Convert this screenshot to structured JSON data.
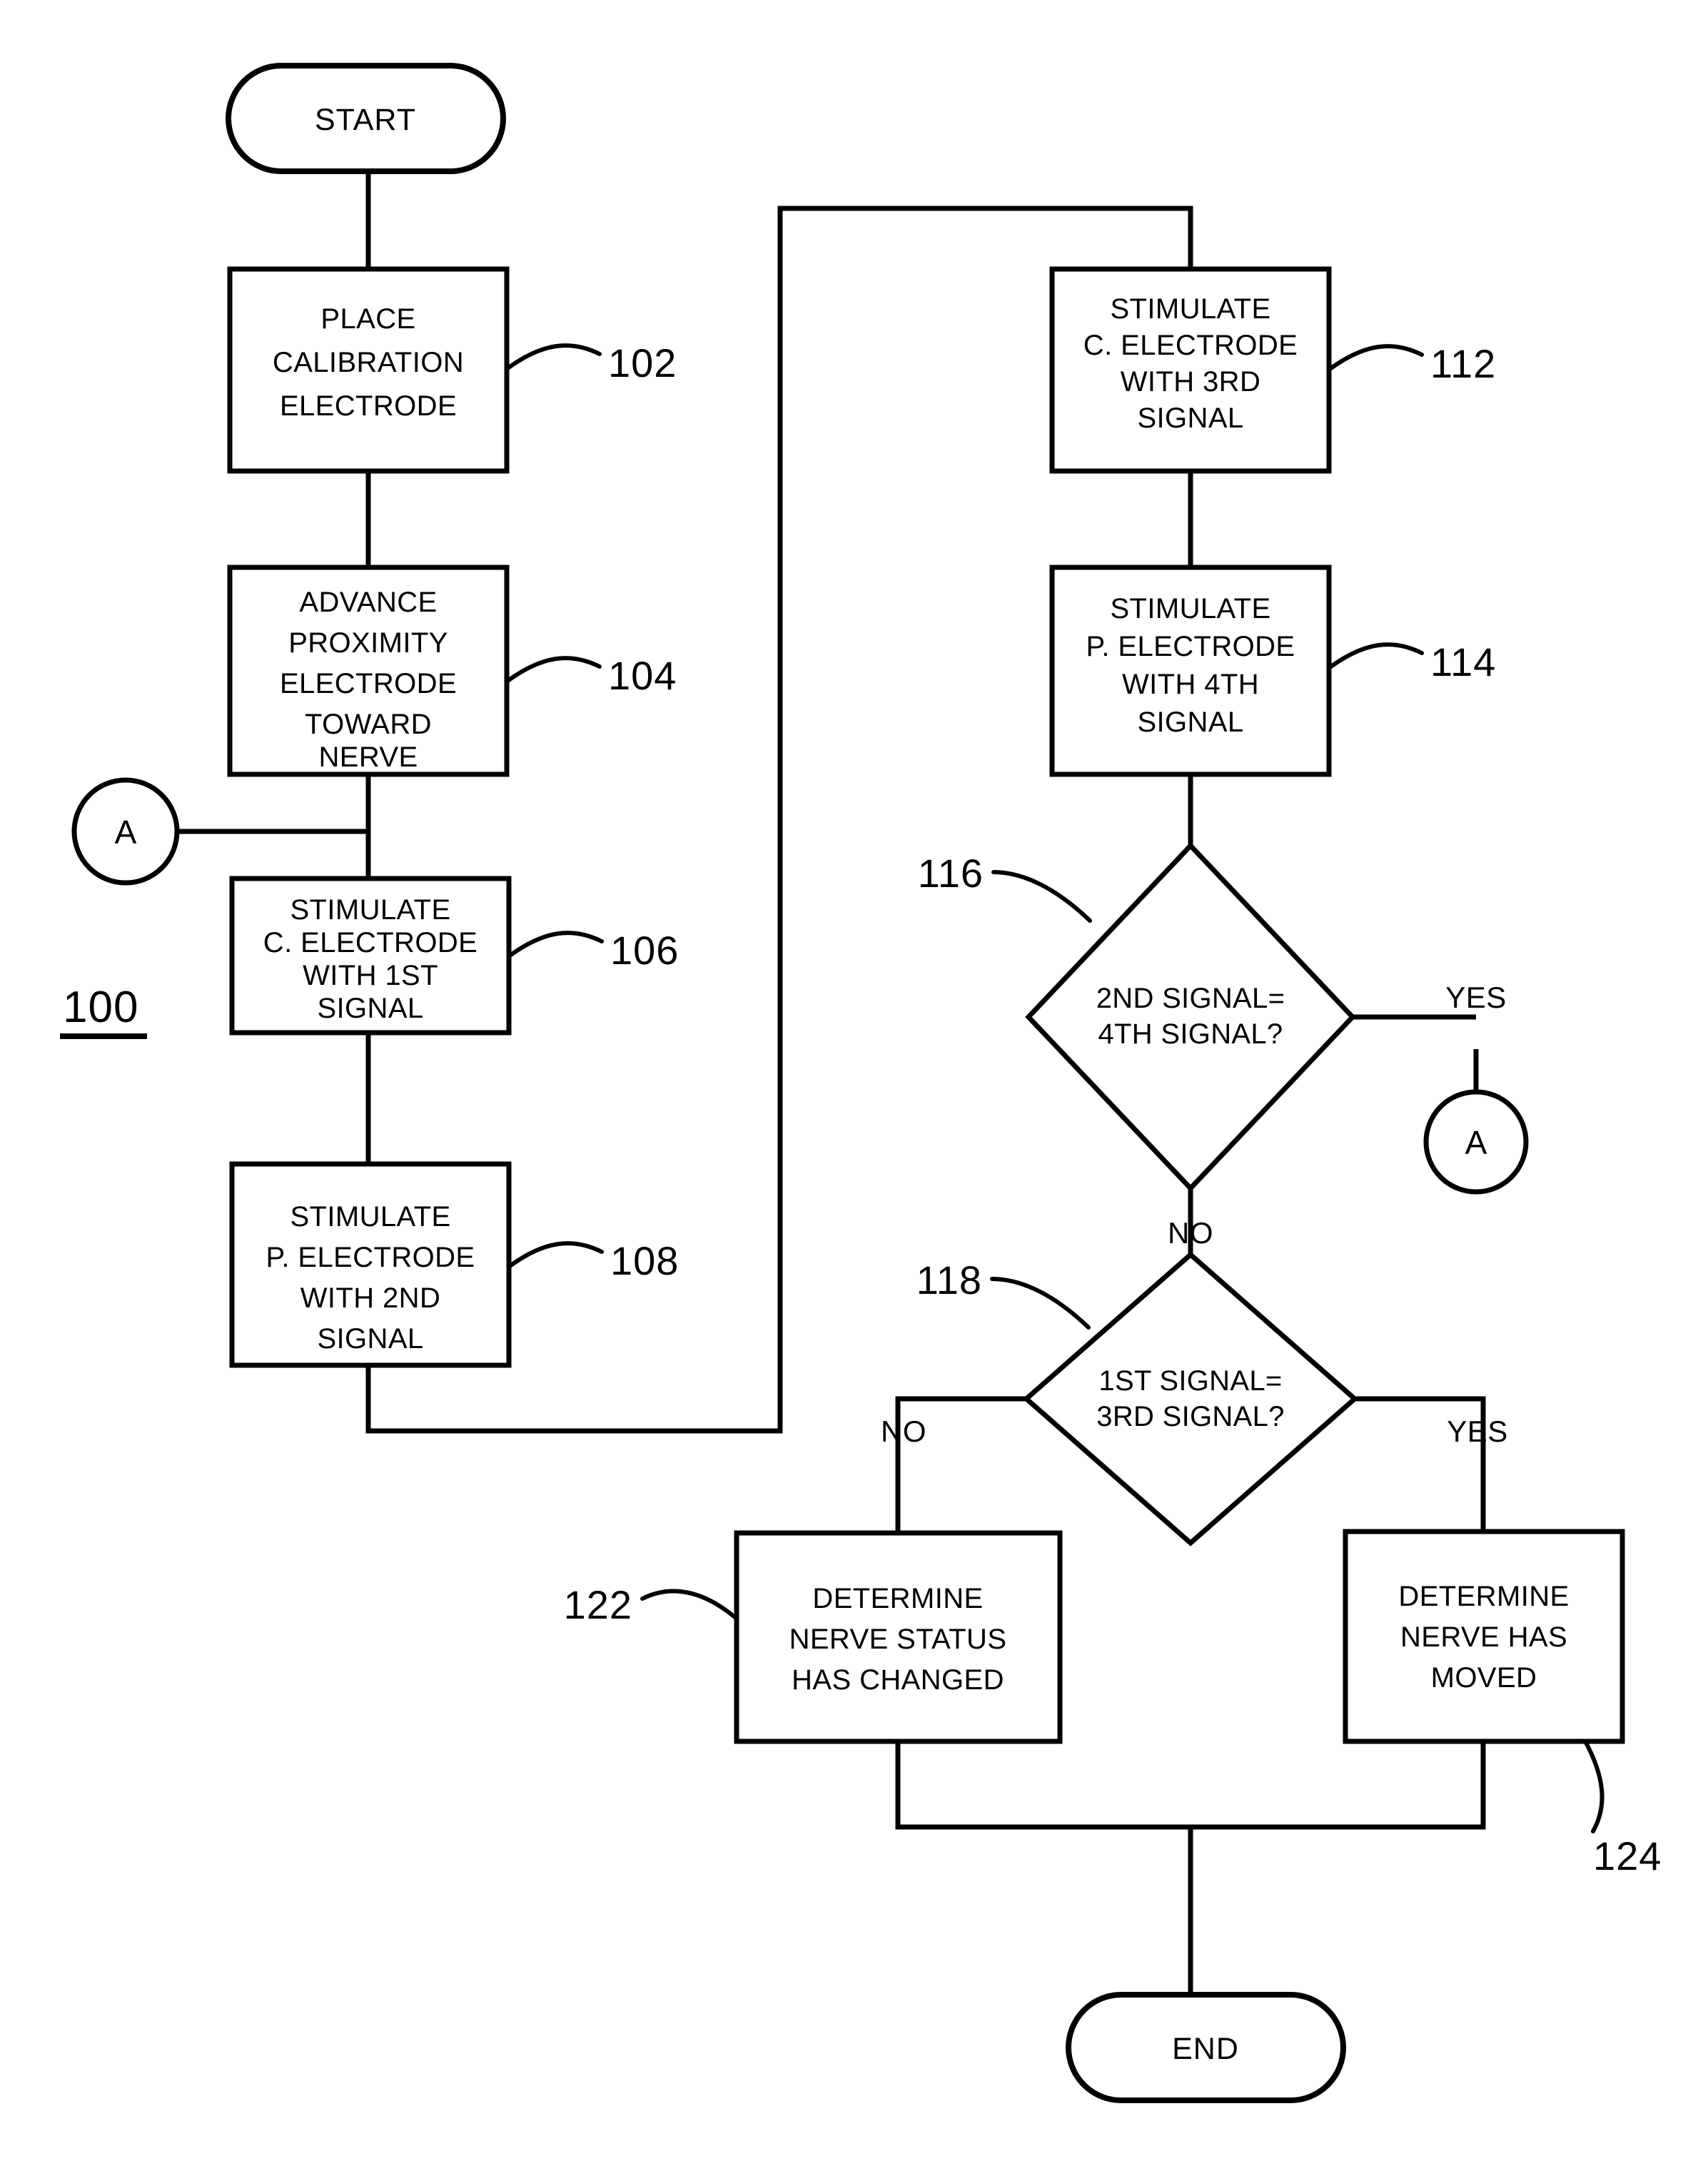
{
  "figure": {
    "number": "100",
    "type": "patent-flowchart"
  },
  "terminators": {
    "start": "START",
    "end": "END"
  },
  "connectors": {
    "a_left": "A",
    "a_right": "A"
  },
  "process_boxes": [
    {
      "ref": "102",
      "lines": [
        "PLACE",
        "CALIBRATION",
        "ELECTRODE"
      ]
    },
    {
      "ref": "104",
      "lines": [
        "ADVANCE",
        "PROXIMITY",
        "ELECTRODE",
        "TOWARD",
        "NERVE"
      ]
    },
    {
      "ref": "106",
      "lines": [
        "STIMULATE",
        "C. ELECTRODE",
        "WITH 1ST",
        "SIGNAL"
      ]
    },
    {
      "ref": "108",
      "lines": [
        "STIMULATE",
        "P. ELECTRODE",
        "WITH 2ND",
        "SIGNAL"
      ]
    },
    {
      "ref": "112",
      "lines": [
        "STIMULATE",
        "C. ELECTRODE",
        "WITH 3RD",
        "SIGNAL"
      ]
    },
    {
      "ref": "114",
      "lines": [
        "STIMULATE",
        "P. ELECTRODE",
        "WITH 4TH",
        "SIGNAL"
      ]
    },
    {
      "ref": "122",
      "lines": [
        "DETERMINE",
        "NERVE STATUS",
        "HAS CHANGED"
      ]
    },
    {
      "ref": "124",
      "lines": [
        "DETERMINE",
        "NERVE HAS",
        "MOVED"
      ]
    }
  ],
  "decisions": [
    {
      "ref": "116",
      "lines": [
        "2ND SIGNAL=",
        "4TH SIGNAL?"
      ],
      "yes_label": "YES",
      "no_label": "NO"
    },
    {
      "ref": "118",
      "lines": [
        "1ST SIGNAL=",
        "3RD SIGNAL?"
      ],
      "yes_label": "YES",
      "no_label": "NO"
    }
  ],
  "colors": {
    "stroke": "#000000",
    "fill": "#ffffff",
    "background": "#ffffff"
  }
}
